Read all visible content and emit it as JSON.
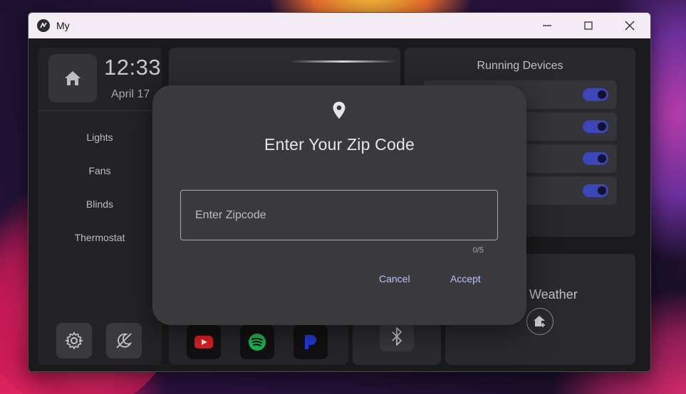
{
  "window": {
    "title": "My",
    "controls": [
      "minimize-icon",
      "maximize-icon",
      "close-icon"
    ]
  },
  "sidebar": {
    "time": "12:33",
    "date": "April 17",
    "items": [
      {
        "label": "Lights"
      },
      {
        "label": "Fans"
      },
      {
        "label": "Blinds"
      },
      {
        "label": "Thermostat"
      }
    ],
    "bottom_buttons": [
      "settings-icon",
      "night-mode-icon"
    ]
  },
  "devices": {
    "title": "Running Devices",
    "rows": [
      {
        "on": true
      },
      {
        "on": true
      },
      {
        "on": true
      },
      {
        "on": true
      }
    ]
  },
  "weather": {
    "title": "Weather"
  },
  "media": {
    "apps": [
      "youtube-icon",
      "spotify-icon",
      "pandora-icon"
    ]
  },
  "bluetooth": {
    "icon": "bluetooth-icon"
  },
  "dialog": {
    "title": "Enter Your Zip Code",
    "input_placeholder": "Enter Zipcode",
    "input_value": "",
    "counter": "0/5",
    "cancel_label": "Cancel",
    "accept_label": "Accept"
  },
  "colors": {
    "accent": "#3b46b8",
    "dialog_button": "#b9c3ff",
    "youtube": "#e02020",
    "spotify": "#1db954",
    "pandora": "#2439d6"
  }
}
